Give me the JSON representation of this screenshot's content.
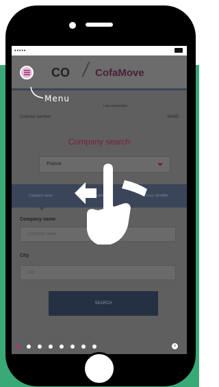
{
  "device": {
    "screen": {
      "app": {
        "menu_annotation": "Menu",
        "logo_text": "CofaMove",
        "logo_symbol": "CO",
        "last_connection": "Last connection",
        "contract": {
          "label": "Contract number",
          "value": "99485"
        },
        "company_search": {
          "title": "Company search",
          "country_value": "France",
          "tabs": [
            "Company name",
            "Identifier",
            "Easy Identifier"
          ],
          "fields": [
            {
              "label": "Company name",
              "placeholder": "Company name"
            },
            {
              "label": "City",
              "placeholder": "City"
            }
          ],
          "search_label": "SEARCH"
        }
      },
      "pager": {
        "count": 8,
        "active_index": 0
      },
      "close_glyph": "×"
    }
  },
  "colors": {
    "background_green": "#3aa978",
    "brand_burgundy": "#7a1f3f",
    "navy": "#3b4559",
    "dot_active": "#a43b78"
  },
  "icons": [
    "hamburger-menu-icon",
    "dropdown-arrow-icon",
    "swipe-gesture-icon",
    "close-icon"
  ]
}
